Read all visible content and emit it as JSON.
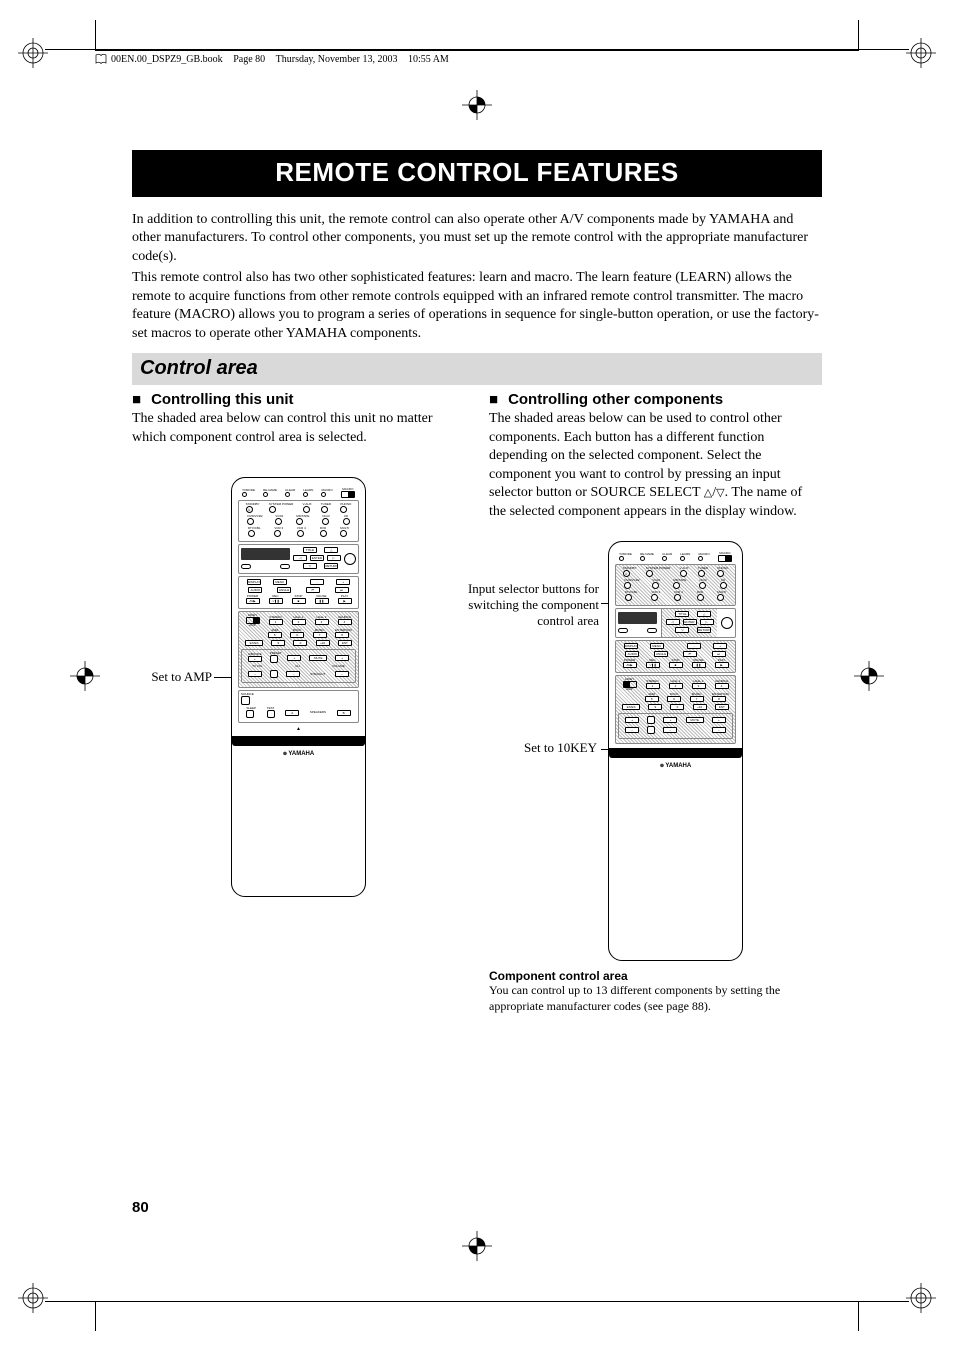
{
  "header": {
    "filename": "00EN.00_DSPZ9_GB.book",
    "page_label": "Page 80",
    "date": "Thursday, November 13, 2003",
    "time": "10:55 AM"
  },
  "title": "REMOTE CONTROL FEATURES",
  "intro": {
    "p1": "In addition to controlling this unit, the remote control can also operate other A/V components made by YAMAHA and other manufacturers. To control other components, you must set up the remote control with the appropriate manufacturer code(s).",
    "p2": "This remote control also has two other sophisticated features: learn and macro. The learn feature (LEARN) allows the remote to acquire functions from other remote controls equipped with an infrared remote control transmitter. The macro feature (MACRO) allows you to program a series of operations in sequence for single-button operation, or use the factory-set macros to operate other YAMAHA components."
  },
  "section_heading": "Control area",
  "left": {
    "subhead": "Controlling this unit",
    "body": "The shaded area below can control this unit no matter which component control area is selected.",
    "callout": "Set to AMP"
  },
  "right": {
    "subhead": "Controlling other components",
    "body_pre": "The shaded areas below can be used to control other components. Each button has a different function depending on the selected component. Select the component you want to control by pressing an input selector button or SOURCE SELECT ",
    "body_post": ". The name of the selected component appears in the display window.",
    "callout1": "Input selector buttons for switching the component control area",
    "callout2": "Set to 10KEY",
    "caption_bold": "Component control area",
    "caption_text": "You can control up to 13 different components by setting the appropriate manufacturer codes (see page 88)."
  },
  "remote": {
    "top_labels": [
      "TVMODE",
      "RE-NAME",
      "CLEAR",
      "LEARN",
      "MACRO",
      "MACRO"
    ],
    "row1_labels": [
      "STANDBY",
      "SYSTEM POWER",
      "V-AUX",
      "TUNER",
      "PHONO"
    ],
    "row2_labels": [
      "DVR/VCR2",
      "VCR1",
      "MD/TAPE",
      "CD-R",
      "CD"
    ],
    "row3_labels": [
      "DTV/CBL",
      "VCR 3",
      "VCR 4",
      "DVD",
      "MULTI"
    ],
    "dpad": [
      "TITLE",
      "ENTER",
      "MENU",
      "RETURN"
    ],
    "mid_labels": [
      "DISPLAY",
      "MENU",
      "SEARCH",
      "CHAPTER",
      "AUDIO",
      "ANGLE"
    ],
    "transport": [
      "POWER",
      "REC",
      "STOP",
      "PAUSE",
      "PLAY"
    ],
    "switch_labels": [
      "10KEY",
      "AMP"
    ],
    "num_labels": [
      "STEREO",
      "HALL 1",
      "HALL 2",
      "CHURCH",
      "JAZZ",
      "ROCK",
      "MUSIC",
      "ENTERTAIN"
    ],
    "nums": [
      "1",
      "2",
      "3",
      "4",
      "5",
      "6",
      "7",
      "8",
      "9",
      "0",
      "+10",
      "ENT"
    ],
    "bottom_btns": [
      "EX/ES",
      "MOVIE",
      "THX",
      "SETS",
      "NIGHT",
      "PURE DIRECT"
    ],
    "vol_area": [
      "A/B/C/D/E",
      "PRESET",
      "MUTE",
      "TV VOL",
      "CH",
      "VOLUME",
      "TV MUTE",
      "STRAIGHT",
      "EFFECT"
    ],
    "misc": [
      "SOURCE",
      "DISPLAY",
      "SELECT",
      "SLEEP",
      "TEST",
      "SPEAKERS",
      "A",
      "B"
    ],
    "brand": "YAMAHA"
  },
  "page_number": "80"
}
